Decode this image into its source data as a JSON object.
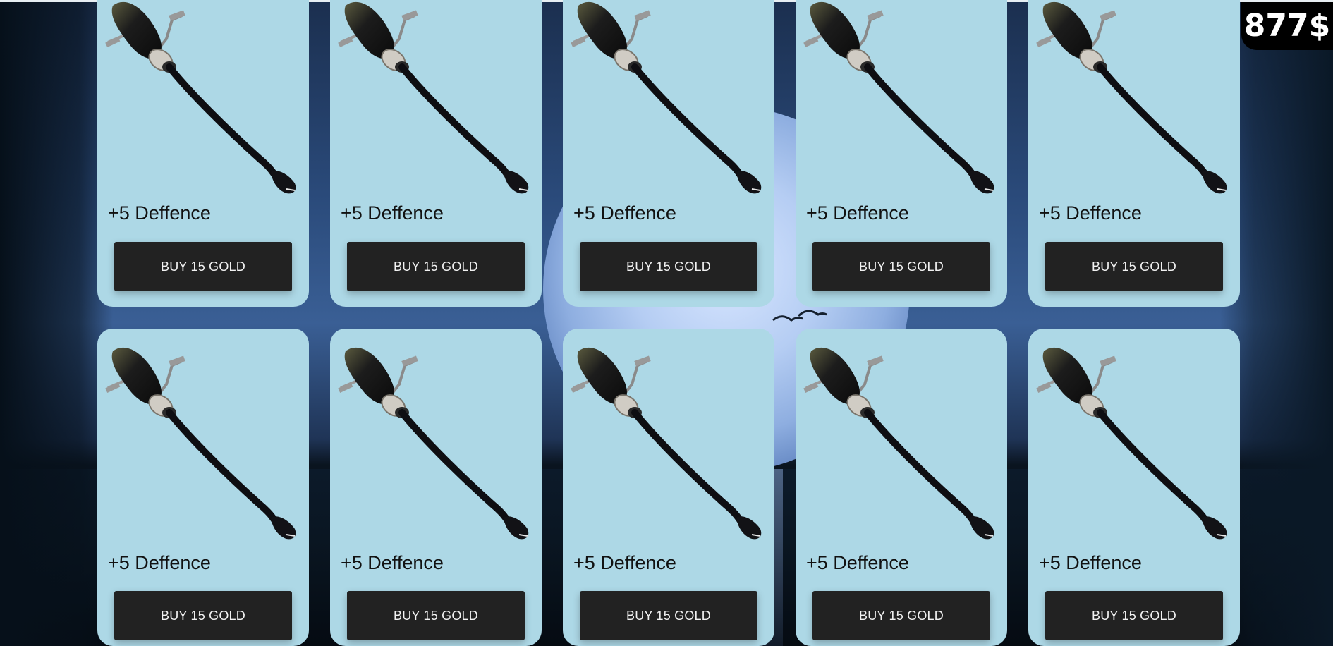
{
  "balance": "877$",
  "shop": {
    "items": [
      {
        "icon": "broomstick-icon",
        "stat": "+5 Deffence",
        "buy_label": "BUY 15 GOLD"
      },
      {
        "icon": "broomstick-icon",
        "stat": "+5 Deffence",
        "buy_label": "BUY 15 GOLD"
      },
      {
        "icon": "broomstick-icon",
        "stat": "+5 Deffence",
        "buy_label": "BUY 15 GOLD"
      },
      {
        "icon": "broomstick-icon",
        "stat": "+5 Deffence",
        "buy_label": "BUY 15 GOLD"
      },
      {
        "icon": "broomstick-icon",
        "stat": "+5 Deffence",
        "buy_label": "BUY 15 GOLD"
      },
      {
        "icon": "broomstick-icon",
        "stat": "+5 Deffence",
        "buy_label": "BUY 15 GOLD"
      },
      {
        "icon": "broomstick-icon",
        "stat": "+5 Deffence",
        "buy_label": "BUY 15 GOLD"
      },
      {
        "icon": "broomstick-icon",
        "stat": "+5 Deffence",
        "buy_label": "BUY 15 GOLD"
      },
      {
        "icon": "broomstick-icon",
        "stat": "+5 Deffence",
        "buy_label": "BUY 15 GOLD"
      },
      {
        "icon": "broomstick-icon",
        "stat": "+5 Deffence",
        "buy_label": "BUY 15 GOLD"
      }
    ]
  },
  "colors": {
    "card_bg": "#add8e6",
    "button_bg": "#222222",
    "button_text": "#f2f2f2",
    "balance_bg": "#000000"
  }
}
